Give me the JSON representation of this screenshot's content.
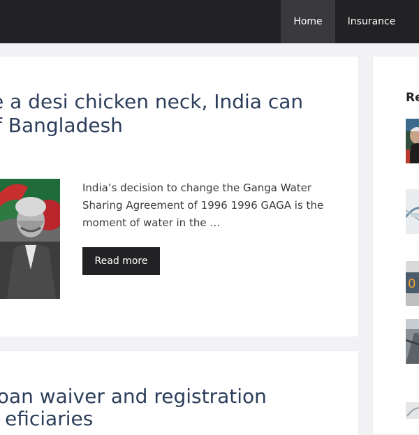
{
  "nav": {
    "items": [
      {
        "label": "Home"
      },
      {
        "label": "Insurance"
      }
    ]
  },
  "posts": [
    {
      "title_lines": [
        "e a desi chicken neck, India can",
        "f Bangladesh"
      ],
      "excerpt": "India’s decision to change the Ganga Water Sharing Agreement of 1996 1996 GAGA is the moment of water in the …",
      "read_more": "Read more"
    },
    {
      "title_lines": [
        " loan waiver and registration",
        "eficiaries"
      ]
    }
  ],
  "sidebar": {
    "heading": "Re"
  },
  "colors": {
    "nav_bg": "#222124",
    "nav_active_bg": "#3a3a3e",
    "title": "#2c3e5a",
    "button_bg": "#222124",
    "page_bg": "#f2f2f4"
  }
}
